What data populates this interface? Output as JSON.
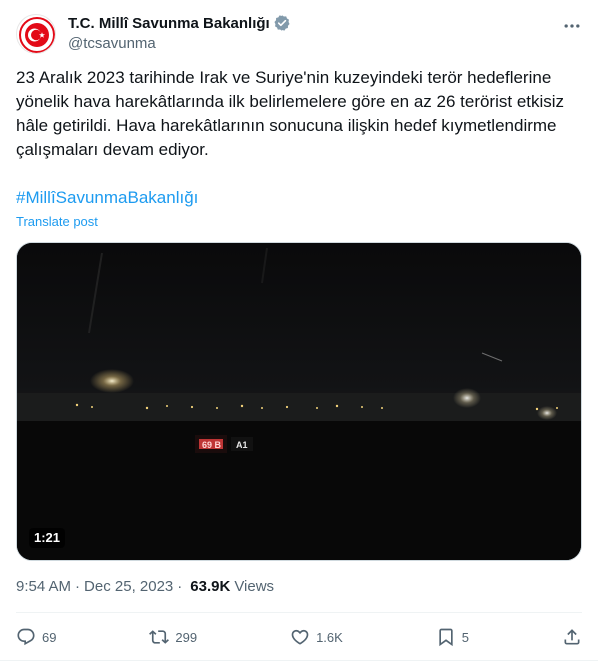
{
  "author": {
    "display_name": "T.C. Millî Savunma Bakanlığı",
    "handle": "@tcsavunma",
    "verified": true,
    "avatar_icon": "ministry-emblem-icon"
  },
  "tweet": {
    "text": "23 Aralık 2023 tarihinde Irak ve Suriye'nin kuzeyindeki  terör hedeflerine yönelik hava harekâtlarında ilk belirlemelere göre en az 26 terörist etkisiz hâle getirildi. Hava harekâtlarının sonucuna ilişkin hedef kıymetlendirme çalışmaları devam ediyor.",
    "hashtag": "#MillîSavunmaBakanlığı",
    "translate_label": "Translate post"
  },
  "media": {
    "type": "video",
    "duration": "1:21",
    "overlay_text": "69 B   A1"
  },
  "meta": {
    "time": "9:54 AM",
    "date": "Dec 25, 2023",
    "views_count": "63.9K",
    "views_label": "Views"
  },
  "actions": {
    "replies": "69",
    "reposts": "299",
    "likes": "1.6K",
    "bookmarks": "5"
  },
  "colors": {
    "accent": "#1d9bf0",
    "secondary_text": "#536471",
    "primary_text": "#0f1419"
  }
}
